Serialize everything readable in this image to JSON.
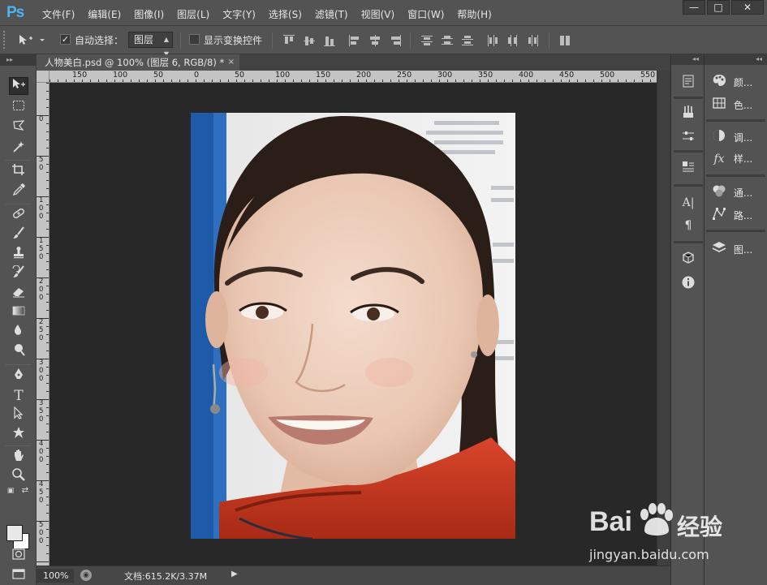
{
  "app": {
    "logo": "Ps"
  },
  "menubar": {
    "items": [
      "文件(F)",
      "编辑(E)",
      "图像(I)",
      "图层(L)",
      "文字(Y)",
      "选择(S)",
      "滤镜(T)",
      "视图(V)",
      "窗口(W)",
      "帮助(H)"
    ],
    "window_buttons": {
      "minimize": "—",
      "restore": "□",
      "close": "✕"
    }
  },
  "options": {
    "auto_select_label": "自动选择：",
    "auto_select_checked": true,
    "auto_select_target": "图层",
    "show_transform_label": "显示变换控件",
    "show_transform_checked": false
  },
  "document": {
    "tab_title": "人物美白.psd @ 100% (图层 6, RGB/8) *",
    "tab_close": "×",
    "ruler_top_labels": [
      "150",
      "100",
      "50",
      "0",
      "50",
      "100",
      "150",
      "200",
      "250",
      "300",
      "350",
      "400",
      "450",
      "500",
      "550"
    ],
    "ruler_left_labels": [
      "0",
      "50",
      "100",
      "150",
      "200",
      "250",
      "300",
      "350",
      "400",
      "450",
      "500"
    ]
  },
  "status": {
    "zoom": "100%",
    "doc_info": "文档:615.2K/3.37M",
    "arrow": "▶"
  },
  "panels": {
    "wide_items": [
      {
        "icon": "palette-icon",
        "label": "颜..."
      },
      {
        "icon": "swatches-icon",
        "label": "色..."
      },
      {
        "icon": "adjustments-icon",
        "label": "调..."
      },
      {
        "icon": "styles-icon",
        "label": "样..."
      },
      {
        "icon": "channels-icon",
        "label": "通..."
      },
      {
        "icon": "paths-icon",
        "label": "路..."
      },
      {
        "icon": "layers-icon",
        "label": "图..."
      }
    ]
  },
  "watermark": {
    "brand": "Bai",
    "brand_cn": "经验",
    "url": "jingyan.baidu.com"
  },
  "colors": {
    "chrome": "#535353",
    "canvas_bg": "#282828",
    "logo_blue": "#4fb4f2"
  }
}
